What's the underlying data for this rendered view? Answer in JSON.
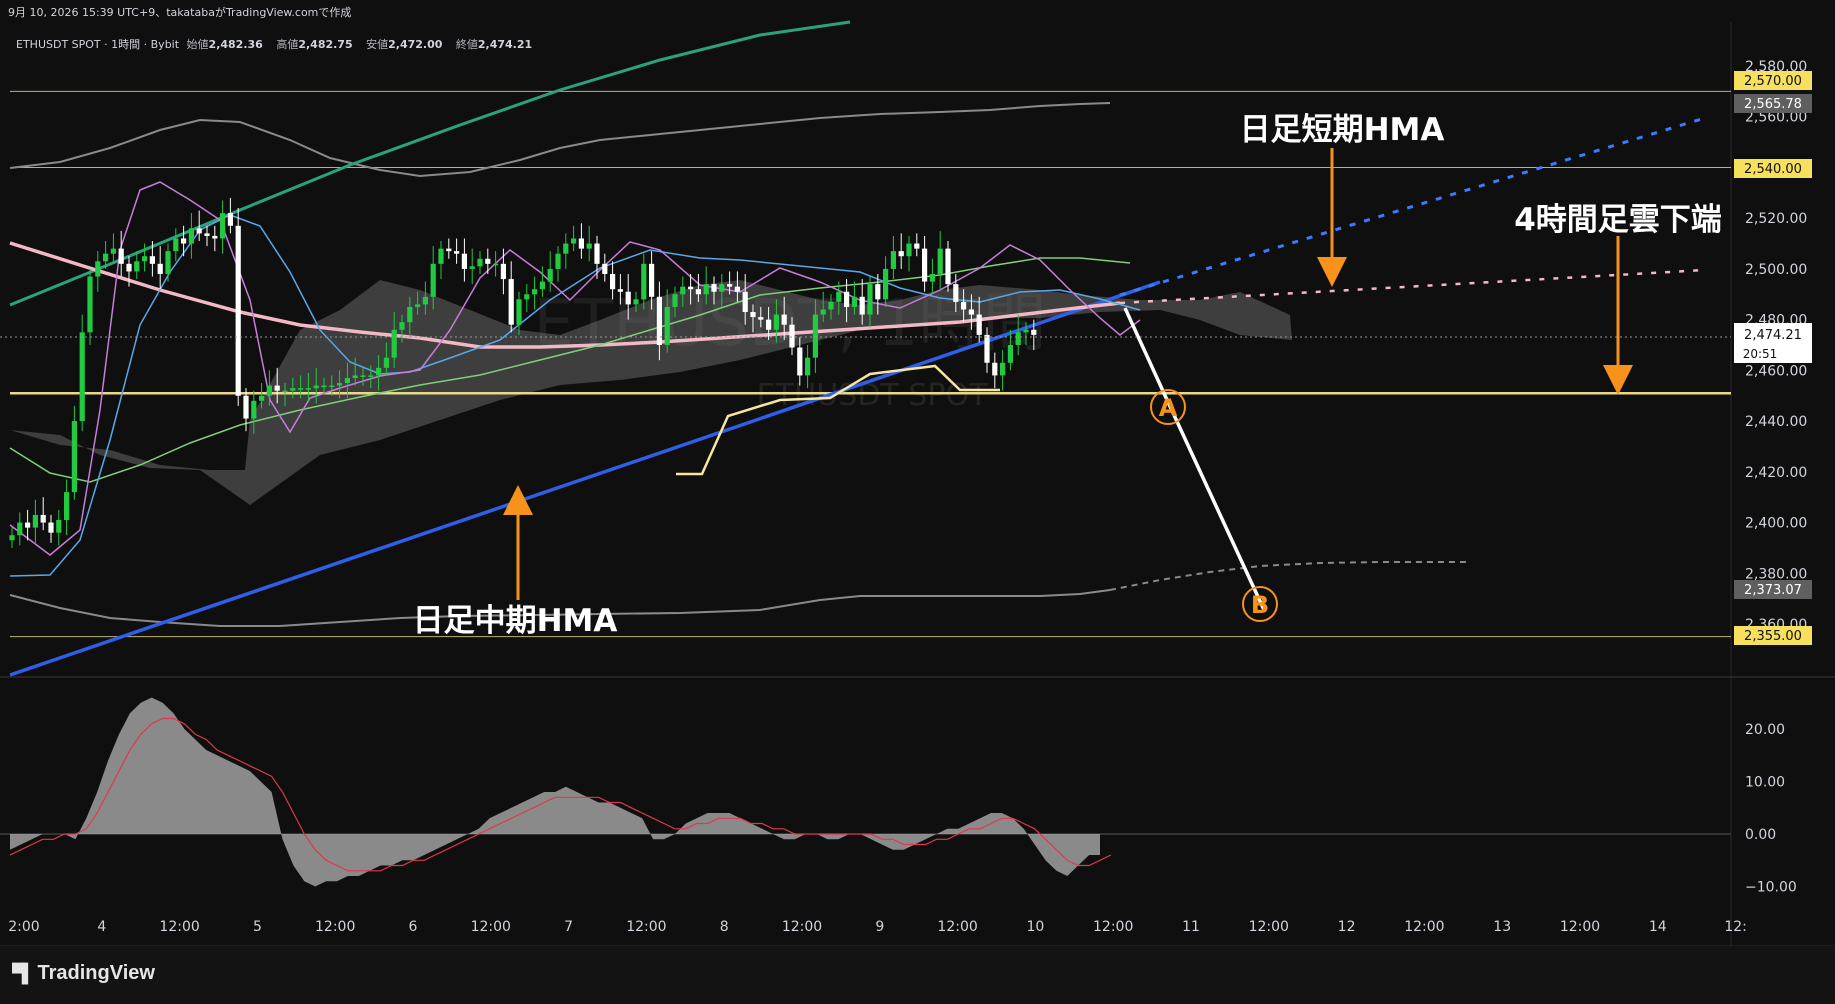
{
  "header": {
    "snapshot_text": "9月 10, 2026 15:39 UTC+9、takatabaがTradingView.comで作成"
  },
  "symbol_bar": {
    "title": "ETHUSDT SPOT · 1時間 · Bybit",
    "open_label": "始値",
    "open_value": "2,482.36",
    "high_label": "高値",
    "high_value": "2,482.75",
    "low_label": "安値",
    "low_value": "2,472.00",
    "close_label": "終値",
    "close_value": "2,474.21"
  },
  "watermark": {
    "main": "ETHUSDT, 1時間",
    "sub": "ETHUSDT SPOT"
  },
  "annotations": {
    "daily_short_hma": "日足短期HMA",
    "daily_mid_hma": "日足中期HMA",
    "h4_cloud_bottom": "4時間足雲下端",
    "point_a": "A",
    "point_b": "B"
  },
  "price_badges": {
    "b2570": "2,570.00",
    "b2565": "2,565.78",
    "b2540": "2,540.00",
    "current": "2,474.21",
    "countdown": "20:51",
    "b2373": "2,373.07",
    "b2355": "2,355.00"
  },
  "colors": {
    "background": "#0f0f0f",
    "up_candle": "#22c943",
    "down_candle": "#ffffff",
    "level_line": "#e8d88a",
    "mid_hma": "#2f5fe8",
    "short_hma_projection": "#3a7bff",
    "pink_line": "#f2b8c6",
    "arrow": "#f7931a"
  },
  "footer": {
    "brand": "TradingView"
  },
  "chart_data": {
    "type": "line",
    "title": "ETHUSDT SPOT · 1時間 · Bybit",
    "x_tick_labels": [
      "2:00",
      "4",
      "12:00",
      "5",
      "12:00",
      "6",
      "12:00",
      "7",
      "12:00",
      "8",
      "12:00",
      "9",
      "12:00",
      "10",
      "12:00",
      "11",
      "12:00",
      "12",
      "12:00",
      "13",
      "12:00",
      "14",
      "12:"
    ],
    "y_tick_labels": [
      "2,580.00",
      "2,560.00",
      "2,540.00",
      "2,520.00",
      "2,500.00",
      "2,480.00",
      "2,460.00",
      "2,440.00",
      "2,420.00",
      "2,400.00",
      "2,380.00",
      "2,360.00"
    ],
    "ylim": [
      2350,
      2590
    ],
    "horizontal_levels": [
      2570,
      2540,
      2451,
      2355
    ],
    "series": [
      {
        "values": [
          2395,
          2400,
          2398,
          2403,
          2400,
          2396,
          2401,
          2412,
          2440,
          2475,
          2497,
          2503,
          2506,
          2508,
          2502,
          2499,
          2503,
          2505,
          2502,
          2498,
          2507,
          2512,
          2510,
          2516,
          2514,
          2513,
          2512,
          2522,
          2517,
          2450,
          2441,
          2448,
          2450,
          2454,
          2452,
          2452,
          2453,
          2453,
          2453,
          2454,
          2454,
          2454,
          2455,
          2457,
          2458,
          2458,
          2458,
          2461,
          2465,
          2476,
          2479,
          2485,
          2486,
          2489,
          2502,
          2508,
          2507,
          2506,
          2500,
          2501,
          2504,
          2502,
          2502,
          2496,
          2478,
          2488,
          2490,
          2492,
          2495,
          2500,
          2506,
          2510,
          2512,
          2508,
          2510,
          2502,
          2498,
          2492,
          2491,
          2486,
          2488,
          2502,
          2489,
          2470,
          2485,
          2490,
          2493,
          2492,
          2490,
          2494,
          2491,
          2494,
          2493,
          2491,
          2483,
          2481,
          2480,
          2476,
          2482,
          2478,
          2469,
          2458,
          2465,
          2482,
          2484,
          2487,
          2491,
          2485,
          2489,
          2482,
          2494,
          2488,
          2500,
          2507,
          2505,
          2510,
          2508,
          2495,
          2498,
          2508,
          2494,
          2487,
          2484,
          2482,
          2474,
          2463,
          2458,
          2463,
          2470,
          2475,
          2476,
          2474
        ]
      }
    ],
    "oscillator": {
      "ylim": [
        -15,
        27
      ],
      "y_tick_labels": [
        "20.00",
        "10.00",
        "0.00",
        "−10.00"
      ],
      "values": [
        -3,
        -2,
        -1,
        0,
        0,
        0,
        -1,
        3,
        8,
        14,
        19,
        23,
        25,
        26,
        25,
        23,
        20,
        18,
        16,
        15,
        14,
        13,
        12,
        10,
        8,
        -1,
        -6,
        -9,
        -10,
        -9,
        -9,
        -8,
        -8,
        -7,
        -6,
        -6,
        -5,
        -5,
        -4,
        -3,
        -2,
        -1,
        0,
        1,
        3,
        4,
        5,
        6,
        7,
        8,
        8,
        9,
        8,
        7,
        6,
        6,
        5,
        4,
        3,
        -1,
        -1,
        0,
        2,
        3,
        4,
        4,
        4,
        3,
        2,
        1,
        0,
        -1,
        -1,
        0,
        0,
        -1,
        -1,
        0,
        0,
        -1,
        -2,
        -3,
        -3,
        -2,
        -1,
        0,
        1,
        1,
        2,
        3,
        4,
        4,
        3,
        1,
        -2,
        -5,
        -7,
        -8,
        -6,
        -4,
        -4
      ],
      "signal": [
        -4,
        -3,
        -2,
        -1,
        -1,
        0,
        0,
        1,
        4,
        8,
        12,
        16,
        19,
        21,
        22,
        22,
        21,
        19,
        18,
        16,
        15,
        14,
        13,
        12,
        11,
        8,
        4,
        0,
        -3,
        -5,
        -6,
        -7,
        -7,
        -7,
        -7,
        -6,
        -6,
        -5,
        -5,
        -4,
        -3,
        -2,
        -1,
        0,
        1,
        2,
        3,
        4,
        5,
        6,
        7,
        7,
        7,
        7,
        7,
        6,
        6,
        5,
        4,
        3,
        2,
        1,
        1,
        2,
        2,
        3,
        3,
        3,
        2,
        2,
        1,
        1,
        0,
        0,
        0,
        0,
        0,
        0,
        0,
        0,
        -1,
        -1,
        -2,
        -2,
        -2,
        -1,
        -1,
        0,
        1,
        1,
        2,
        3,
        3,
        2,
        1,
        -1,
        -3,
        -5,
        -6,
        -6,
        -5,
        -4
      ]
    }
  }
}
